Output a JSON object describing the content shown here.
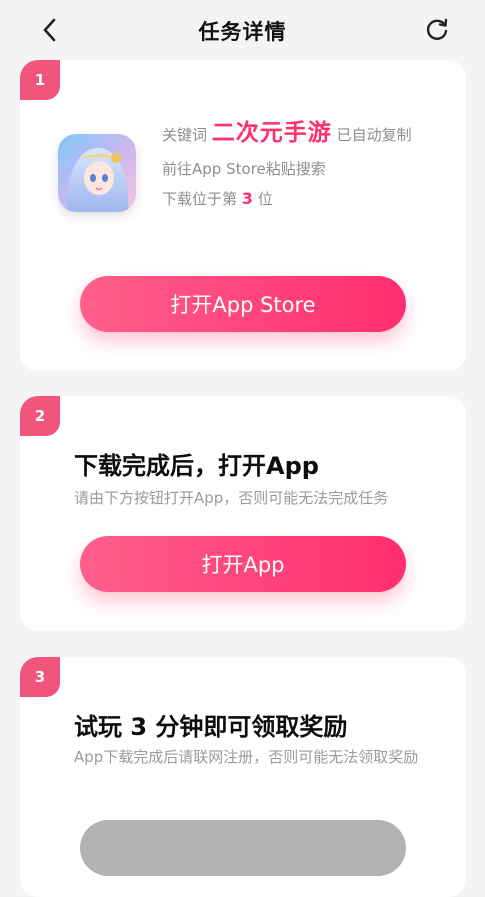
{
  "nav": {
    "title": "任务详情",
    "back_icon": "chevron-left-icon",
    "refresh_icon": "refresh-icon"
  },
  "colors": {
    "accent": "#ff2f6e",
    "step_badge": "#f2557b",
    "button_gradient_start": "#ff5f8d",
    "button_gradient_end": "#ff2d6f",
    "disabled_button": "#b3b3b3"
  },
  "step1": {
    "number": "1",
    "keyword_prefix": "关键词",
    "keyword": "二次元手游",
    "keyword_suffix": "已自动复制",
    "instruction": "前往App Store粘贴搜索",
    "rank_prefix": "下载位于第",
    "rank_value": "3",
    "rank_suffix": "位",
    "button_label": "打开App Store"
  },
  "step2": {
    "number": "2",
    "title": "下载完成后，打开App",
    "description": "请由下方按钮打开App，否则可能无法完成任务",
    "button_label": "打开App"
  },
  "step3": {
    "number": "3",
    "title": "试玩 3 分钟即可领取奖励",
    "description": "App下载完成后请联网注册，否则可能无法领取奖励"
  }
}
